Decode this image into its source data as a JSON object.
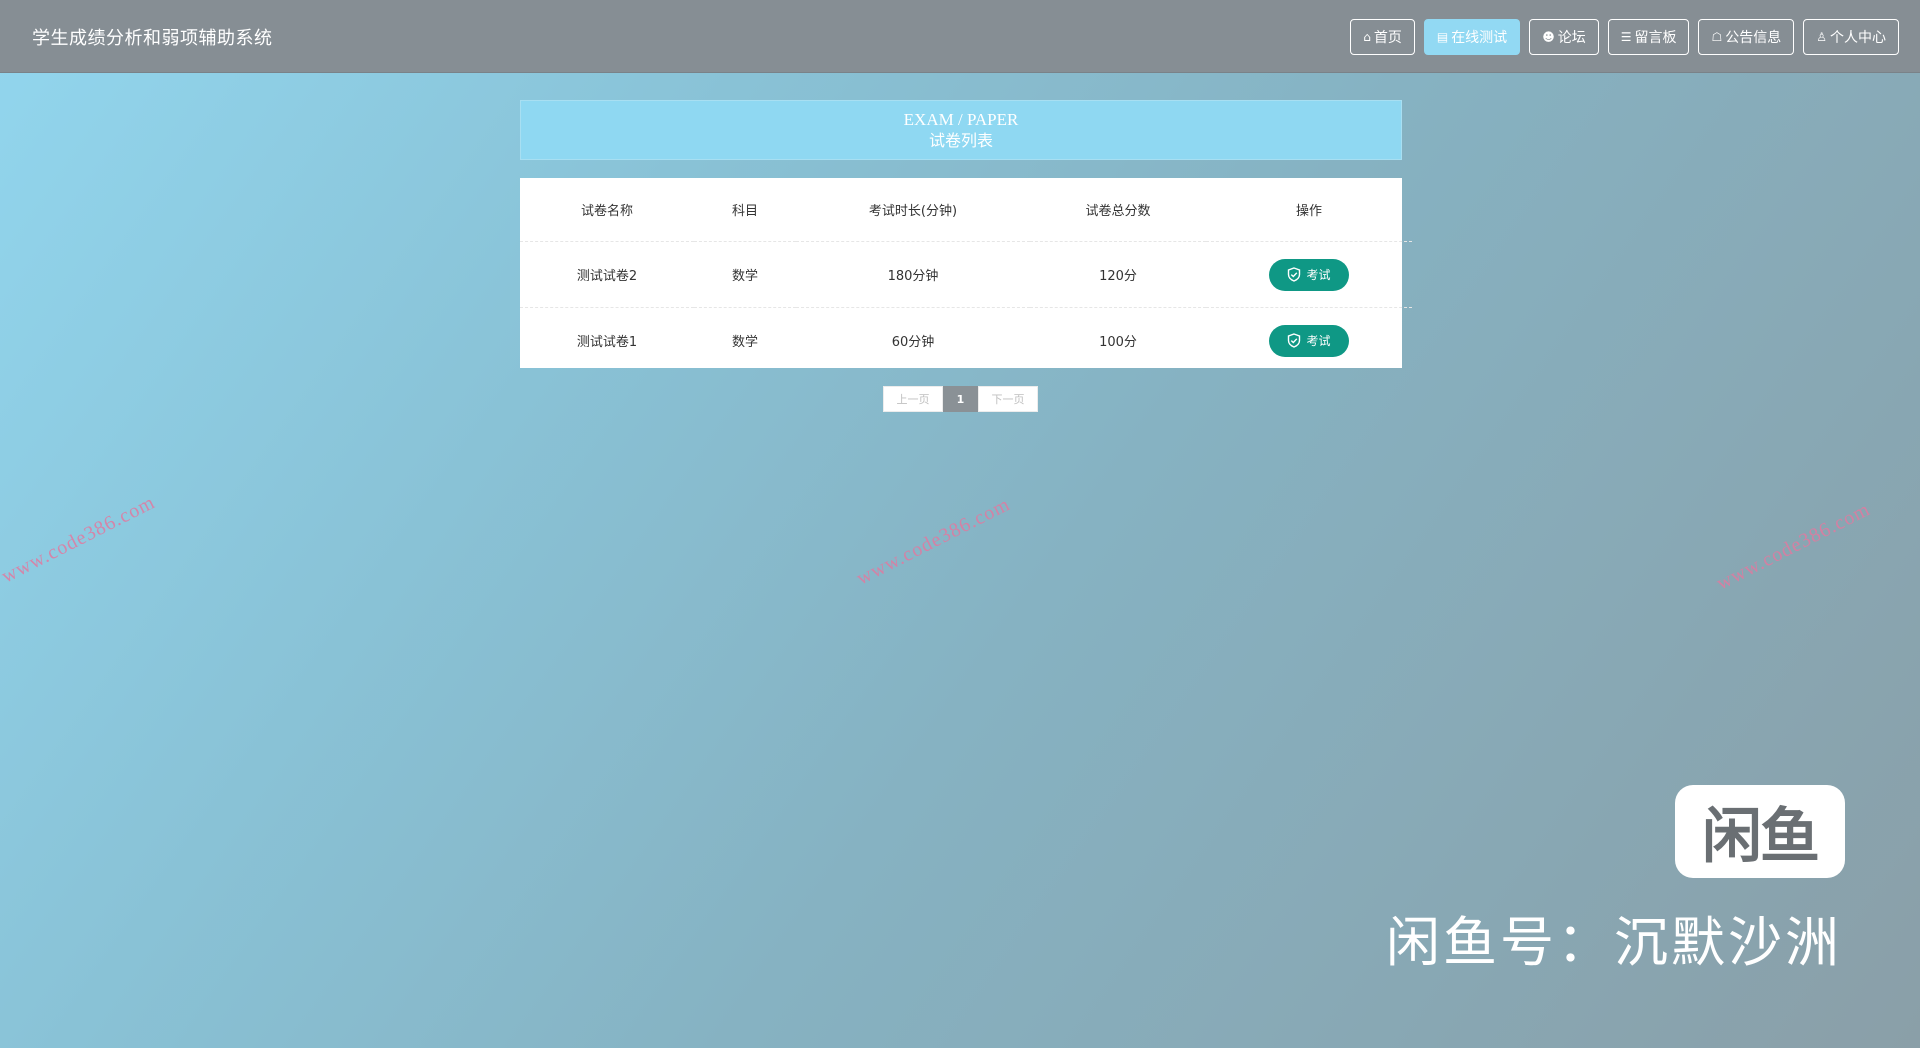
{
  "app_title": "学生成绩分析和弱项辅助系统",
  "nav": [
    {
      "icon": "home-icon",
      "glyph": "⌂",
      "label": "首页",
      "active": false
    },
    {
      "icon": "exam-icon",
      "glyph": "▤",
      "label": "在线测试",
      "active": true
    },
    {
      "icon": "forum-icon",
      "glyph": "☻",
      "label": "论坛",
      "active": false
    },
    {
      "icon": "message-icon",
      "glyph": "☰",
      "label": "留言板",
      "active": false
    },
    {
      "icon": "notice-icon",
      "glyph": "☖",
      "label": "公告信息",
      "active": false
    },
    {
      "icon": "user-icon",
      "glyph": "♙",
      "label": "个人中心",
      "active": false
    }
  ],
  "header": {
    "en": "EXAM / PAPER",
    "cn": "试卷列表"
  },
  "table": {
    "columns": [
      "试卷名称",
      "科目",
      "考试时长(分钟)",
      "试卷总分数",
      "操作"
    ],
    "rows": [
      {
        "name": "测试试卷2",
        "subject": "数学",
        "duration": "180分钟",
        "score": "120分",
        "action": "考试"
      },
      {
        "name": "测试试卷1",
        "subject": "数学",
        "duration": "60分钟",
        "score": "100分",
        "action": "考试"
      }
    ]
  },
  "pager": {
    "prev": "上一页",
    "current": "1",
    "next": "下一页"
  },
  "watermark": "www.code386.com",
  "logo_text": "闲鱼",
  "seller_text": "闲鱼号：沉默沙洲",
  "colors": {
    "topbar": "#868e94",
    "active_nav": "#92d9f3",
    "exam_button": "#0f9885",
    "header_box": "#8fd8f2"
  }
}
